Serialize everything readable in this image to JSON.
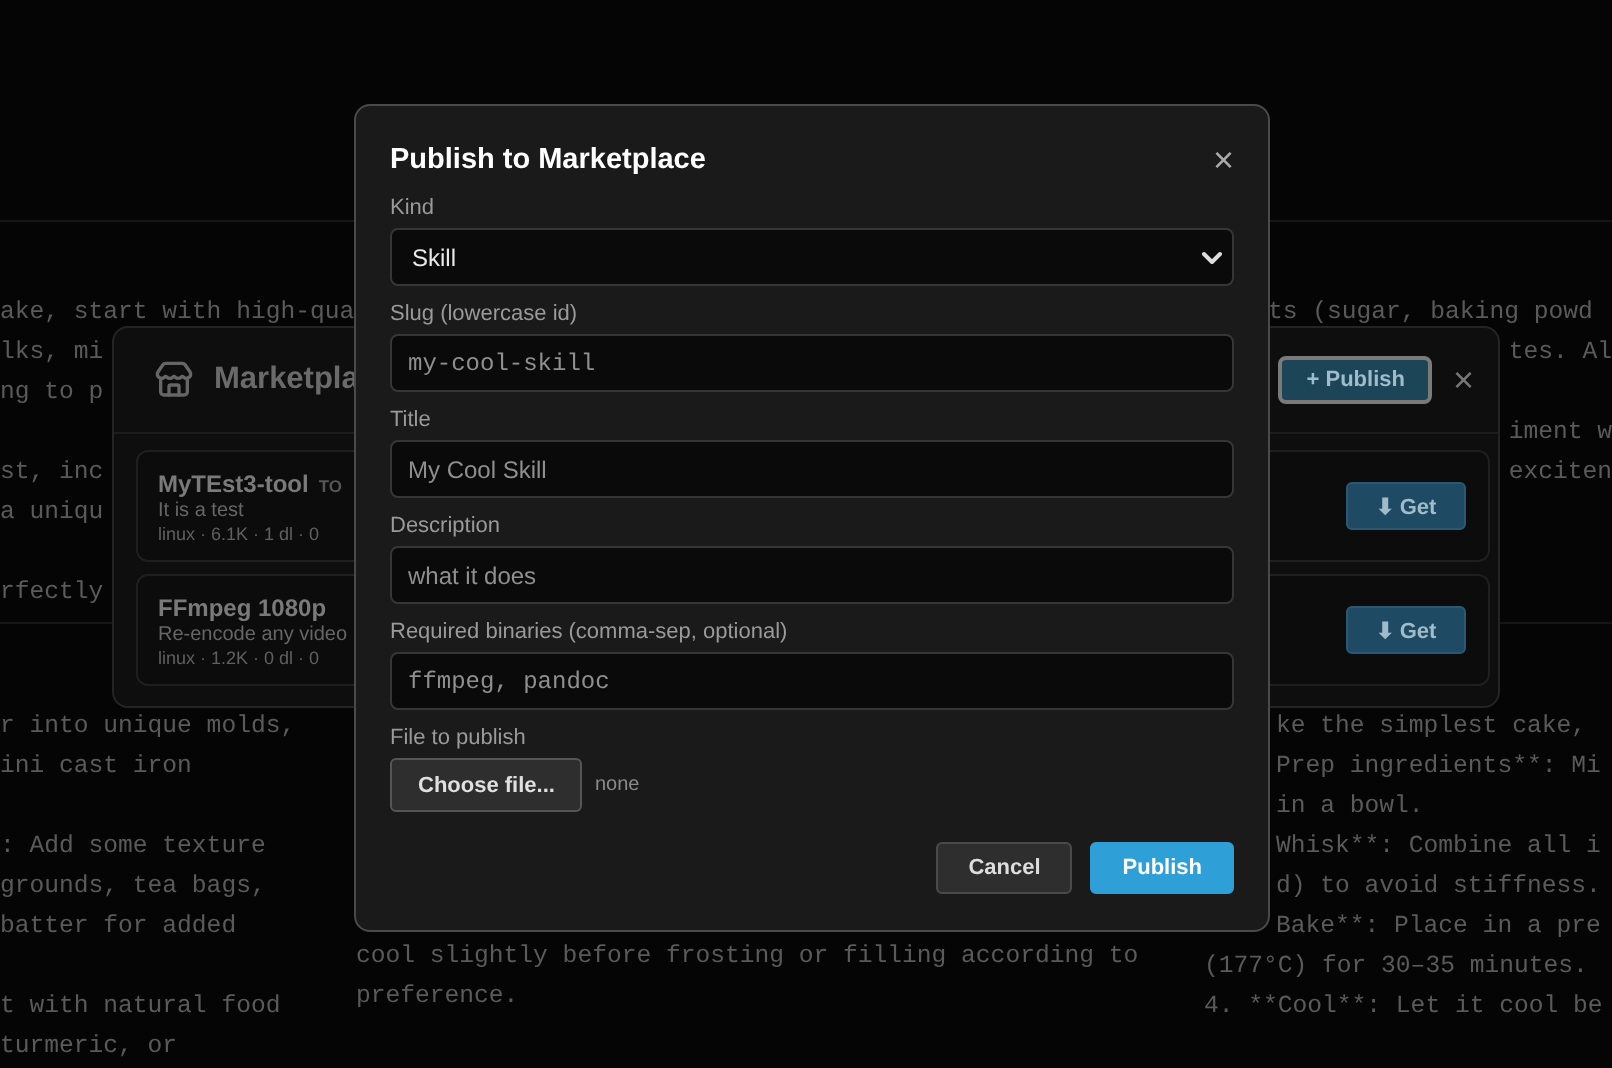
{
  "background_panes": [
    {
      "paragraphs": [
        [
          {
            "text": "ake, start with high-qua",
            "kind": "plain"
          },
          {
            "text": "lks, mi",
            "kind": "plain"
          },
          {
            "text": "ng to p",
            "kind": "plain"
          }
        ],
        [
          {
            "text": "st, inc",
            "kind": "plain"
          },
          {
            "text": "a uniqu",
            "kind": "plain"
          }
        ],
        [
          {
            "text": "rfectly",
            "kind": "plain"
          }
        ]
      ]
    },
    {
      "paragraphs": [
        [
          {
            "text": "ts (sugar, baking powd",
            "kind": "indent"
          },
          {
            "text": "tes. Al",
            "kind": "tail"
          }
        ],
        [
          {
            "text": "iment w",
            "kind": "tail"
          },
          {
            "text": "exciten",
            "kind": "tail"
          }
        ]
      ]
    },
    {
      "paragraphs": [
        [
          {
            "text": "r into unique molds,",
            "kind": "plain"
          },
          {
            "text": "ini cast iron",
            "kind": "plain"
          }
        ],
        [
          {
            "text": ": Add some texture",
            "kind": "plain"
          },
          {
            "text": "grounds, tea bags,",
            "kind": "plain"
          },
          {
            "text": "batter for added",
            "kind": "plain"
          }
        ],
        [
          {
            "text": "t with natural food",
            "kind": "plain"
          },
          {
            "text": "turmeric, or",
            "kind": "plain"
          }
        ]
      ]
    },
    {
      "paragraphs": [
        [
          {
            "text": "cool slightly before frosting or filling according to",
            "kind": "plain"
          },
          {
            "text": "preference.",
            "kind": "plain"
          }
        ]
      ]
    },
    {
      "paragraphs": [
        [
          {
            "text": "ke the simplest cake,",
            "kind": "indent"
          },
          {
            "text": "Prep ingredients**: Mi",
            "kind": "indent"
          },
          {
            "text": "in a bowl.",
            "kind": "indent"
          },
          {
            "text": "Whisk**: Combine all i",
            "kind": "indent"
          },
          {
            "text": "d) to avoid stiffness.",
            "kind": "indent"
          },
          {
            "text": "Bake**: Place in a pre",
            "kind": "indent"
          },
          {
            "text": "(177°C) for 30–35 minutes.",
            "kind": "plain"
          },
          {
            "text": "4. **Cool**: Let it cool be",
            "kind": "plain"
          }
        ]
      ]
    }
  ],
  "marketplace": {
    "title": "Marketpla",
    "publish_button": "+ Publish",
    "close": "×",
    "items": [
      {
        "name": "MyTEst3-tool",
        "badge": "TO",
        "description": "It is a test",
        "meta": "linux · 6.1K · 1 dl · 0",
        "action": "⬇ Get"
      },
      {
        "name": "FFmpeg 1080p",
        "description": "Re-encode any video",
        "meta": "linux · 1.2K · 0 dl · 0",
        "action": "⬇ Get"
      }
    ]
  },
  "dialog": {
    "title": "Publish to Marketplace",
    "close": "×",
    "fields": [
      {
        "kind": "select",
        "label": "Kind",
        "value": "Skill"
      },
      {
        "kind": "text",
        "label": "Slug (lowercase id)",
        "placeholder": "my-cool-skill",
        "mono": true
      },
      {
        "kind": "text",
        "label": "Title",
        "placeholder": "My Cool Skill",
        "mono": false
      },
      {
        "kind": "text",
        "label": "Description",
        "placeholder": "what it does",
        "mono": false
      },
      {
        "kind": "text",
        "label": "Required binaries (comma-sep, optional)",
        "placeholder": "ffmpeg, pandoc",
        "mono": true
      },
      {
        "kind": "file",
        "label": "File to publish",
        "button": "Choose file...",
        "status": "none"
      }
    ],
    "buttons": [
      {
        "label": "Cancel",
        "primary": false
      },
      {
        "label": "Publish",
        "primary": true
      }
    ]
  }
}
